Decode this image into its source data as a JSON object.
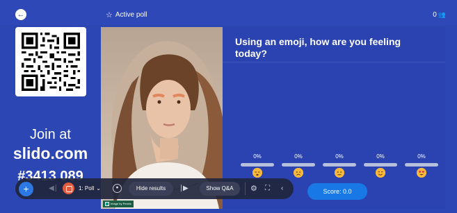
{
  "header": {
    "back_icon": "arrow-left-icon",
    "title": "Active poll",
    "title_icon": "star-outline-icon",
    "participant_count": "0",
    "participants_icon": "people-icon"
  },
  "join": {
    "label": "Join at",
    "url": "slido.com",
    "code": "#3413 089"
  },
  "photo": {
    "credit": "Image by Pexels"
  },
  "poll": {
    "question": "Using an emoji, how are you feeling today?",
    "options": [
      {
        "percent": "0%",
        "emoji": "sleepy-face",
        "value": 0
      },
      {
        "percent": "0%",
        "emoji": "sad-face",
        "value": 0
      },
      {
        "percent": "0%",
        "emoji": "neutral-face",
        "value": 0
      },
      {
        "percent": "0%",
        "emoji": "smiling-face",
        "value": 0
      },
      {
        "percent": "0%",
        "emoji": "heart-eyes-face",
        "value": 0
      }
    ],
    "score_label": "Score: 0.0"
  },
  "controls": {
    "add_icon": "plus-icon",
    "prev_icon": "skip-previous-icon",
    "stop_icon": "stop-icon",
    "poll_select": "1: Poll",
    "lock_icon": "lock-icon",
    "hide_results": "Hide results",
    "next_icon": "skip-next-icon",
    "show_qa": "Show Q&A",
    "gear_icon": "gear-icon",
    "fullscreen_icon": "fullscreen-icon",
    "collapse_icon": "chevron-left-icon"
  },
  "colors": {
    "background": "#2c46b4",
    "accent": "#1778e6",
    "stop": "#e25b3f",
    "emoji": "#f6b93b"
  }
}
